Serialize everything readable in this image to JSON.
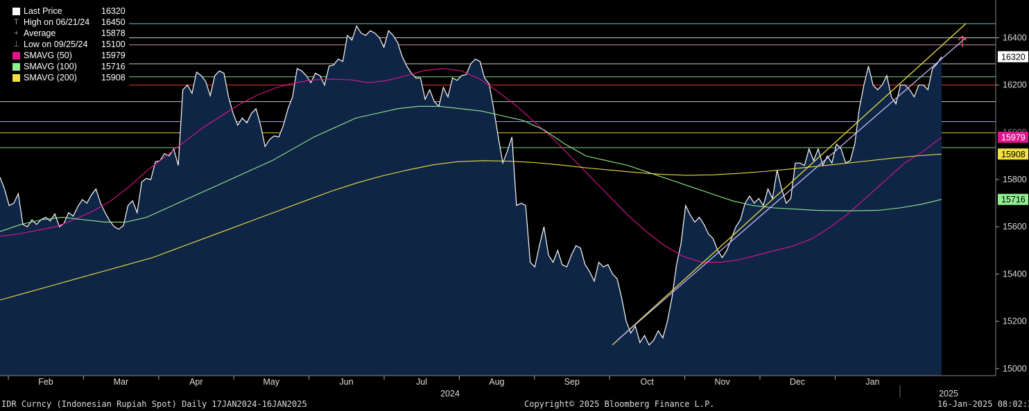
{
  "legend": [
    {
      "label": "Last Price",
      "value": "16320",
      "swatch": "#ffffff",
      "glyph": "box"
    },
    {
      "label": "High on 06/21/24",
      "value": "16450",
      "swatch": "",
      "glyph": "T"
    },
    {
      "label": "Average",
      "value": "15878",
      "swatch": "",
      "glyph": "+"
    },
    {
      "label": "Low on 09/25/24",
      "value": "15100",
      "swatch": "",
      "glyph": "⊥"
    },
    {
      "label": "SMAVG (50)",
      "value": "15979",
      "swatch": "#e0158c",
      "glyph": "box"
    },
    {
      "label": "SMAVG (100)",
      "value": "15716",
      "swatch": "#90ee90",
      "glyph": "box"
    },
    {
      "label": "SMAVG (200)",
      "value": "15908",
      "swatch": "#f0e040",
      "glyph": "box"
    }
  ],
  "footer": {
    "left": "IDR Curncy (Indonesian Rupiah Spot)  Daily 17JAN2024-16JAN2025",
    "center": "Copyright© 2025 Bloomberg Finance L.P.",
    "right": "16-Jan-2025 08:02:32"
  },
  "chart_data": {
    "type": "line",
    "ylim": [
      14970,
      16560
    ],
    "y_ticks": [
      15000,
      15200,
      15400,
      15600,
      15800,
      16200,
      16400
    ],
    "x_labels": [
      "Feb",
      "Mar",
      "Apr",
      "May",
      "Jun",
      "Jul",
      "Aug",
      "Sep",
      "Oct",
      "Nov",
      "Dec",
      "Jan"
    ],
    "year_labels": [
      "2024",
      "2025"
    ],
    "badges": [
      {
        "value": "16320",
        "bg": "#ffffff",
        "fg": "#000000"
      },
      {
        "value": "15979",
        "bg": "#e0158c",
        "fg": "#ffffff"
      },
      {
        "value": "15908",
        "bg": "#f0e040",
        "fg": "#000000"
      },
      {
        "value": "15716",
        "bg": "#90ee90",
        "fg": "#000000"
      }
    ],
    "colors": {
      "price": "#ffffff",
      "area": "#0f2545",
      "sma50": "#e0158c",
      "sma100": "#90ee90",
      "sma200": "#f0e040",
      "trend1": "#f0e040",
      "trend2": "#c8b8ff"
    },
    "horizontal_lines": [
      {
        "y": 16460,
        "color": "#7fd8e8"
      },
      {
        "y": 16400,
        "color": "#dddddd"
      },
      {
        "y": 16370,
        "color": "#e0a0c0"
      },
      {
        "y": 16290,
        "color": "#dddddd"
      },
      {
        "y": 16235,
        "color": "#90ee90"
      },
      {
        "y": 16200,
        "color": "#ff4040"
      },
      {
        "y": 16130,
        "color": "#dddddd"
      },
      {
        "y": 16045,
        "color": "#b0b0ff"
      },
      {
        "y": 15998,
        "color": "#f0e040"
      },
      {
        "y": 15935,
        "color": "#90ee90"
      }
    ],
    "series": [
      {
        "key": "price",
        "values": [
          15810,
          15760,
          15690,
          15700,
          15740,
          15610,
          15600,
          15630,
          15610,
          15630,
          15640,
          15625,
          15655,
          15600,
          15615,
          15660,
          15645,
          15685,
          15715,
          15700,
          15735,
          15760,
          15700,
          15660,
          15625,
          15600,
          15590,
          15605,
          15690,
          15710,
          15660,
          15790,
          15805,
          15800,
          15875,
          15880,
          15910,
          15900,
          15930,
          15860,
          16180,
          16200,
          16165,
          16255,
          16240,
          16215,
          16155,
          16240,
          16260,
          16250,
          16150,
          16080,
          16030,
          16060,
          16040,
          16080,
          16100,
          16030,
          15940,
          15970,
          15985,
          15980,
          16030,
          16100,
          16150,
          16270,
          16260,
          16240,
          16210,
          16250,
          16240,
          16200,
          16280,
          16285,
          16310,
          16300,
          16410,
          16390,
          16450,
          16420,
          16410,
          16430,
          16420,
          16400,
          16360,
          16430,
          16410,
          16380,
          16320,
          16280,
          16250,
          16230,
          16230,
          16140,
          16180,
          16130,
          16110,
          16190,
          16150,
          16230,
          16220,
          16240,
          16245,
          16290,
          16310,
          16300,
          16230,
          16205,
          16100,
          15980,
          15870,
          15920,
          15980,
          15690,
          15700,
          15690,
          15450,
          15430,
          15520,
          15600,
          15480,
          15450,
          15500,
          15440,
          15430,
          15480,
          15520,
          15510,
          15440,
          15410,
          15370,
          15450,
          15430,
          15440,
          15400,
          15380,
          15300,
          15200,
          15150,
          15180,
          15110,
          15140,
          15100,
          15120,
          15160,
          15130,
          15200,
          15300,
          15440,
          15530,
          15690,
          15650,
          15620,
          15640,
          15610,
          15570,
          15550,
          15500,
          15470,
          15500,
          15550,
          15600,
          15630,
          15700,
          15730,
          15700,
          15720,
          15690,
          15760,
          15720,
          15840,
          15760,
          15700,
          15720,
          15870,
          15870,
          15860,
          15930,
          15880,
          15930,
          15860,
          15900,
          15870,
          15950,
          15930,
          15870,
          15880,
          15950,
          16100,
          16200,
          16280,
          16200,
          16180,
          16200,
          16240,
          16150,
          16120,
          16200,
          16200,
          16180,
          16150,
          16200,
          16200,
          16180,
          16270,
          16290,
          16320
        ]
      },
      {
        "key": "sma50",
        "values": [
          15560,
          15570,
          15585,
          15600,
          15630,
          15665,
          15710,
          15770,
          15840,
          15900,
          15960,
          16020,
          16070,
          16120,
          16160,
          16190,
          16210,
          16222,
          16225,
          16222,
          16210,
          16220,
          16240,
          16262,
          16270,
          16260,
          16225,
          16170,
          16110,
          16040,
          15970,
          15890,
          15810,
          15730,
          15650,
          15580,
          15520,
          15475,
          15450,
          15450,
          15460,
          15480,
          15500,
          15520,
          15550,
          15600,
          15660,
          15730,
          15800,
          15870,
          15920,
          15979
        ]
      },
      {
        "key": "sma100",
        "values": [
          15580,
          15610,
          15630,
          15640,
          15630,
          15620,
          15620,
          15640,
          15680,
          15720,
          15760,
          15800,
          15840,
          15880,
          15930,
          15980,
          16020,
          16060,
          16080,
          16100,
          16110,
          16110,
          16100,
          16090,
          16070,
          16050,
          16010,
          15950,
          15900,
          15880,
          15860,
          15830,
          15800,
          15770,
          15740,
          15710,
          15690,
          15680,
          15675,
          15670,
          15668,
          15668,
          15670,
          15680,
          15695,
          15716
        ]
      },
      {
        "key": "sma200",
        "values": [
          15290,
          15320,
          15350,
          15380,
          15410,
          15440,
          15470,
          15510,
          15550,
          15590,
          15630,
          15670,
          15710,
          15750,
          15785,
          15815,
          15840,
          15862,
          15876,
          15880,
          15878,
          15872,
          15862,
          15850,
          15840,
          15830,
          15822,
          15818,
          15820,
          15826,
          15834,
          15844,
          15855,
          15866,
          15878,
          15890,
          15900,
          15908
        ]
      }
    ],
    "trendlines": [
      {
        "x0": 0.615,
        "y0": 15100,
        "x1": 0.97,
        "y1": 16460,
        "color_key": "trend1"
      },
      {
        "x0": 0.62,
        "y0": 15120,
        "x1": 0.97,
        "y1": 16400,
        "color_key": "trend2"
      }
    ]
  }
}
